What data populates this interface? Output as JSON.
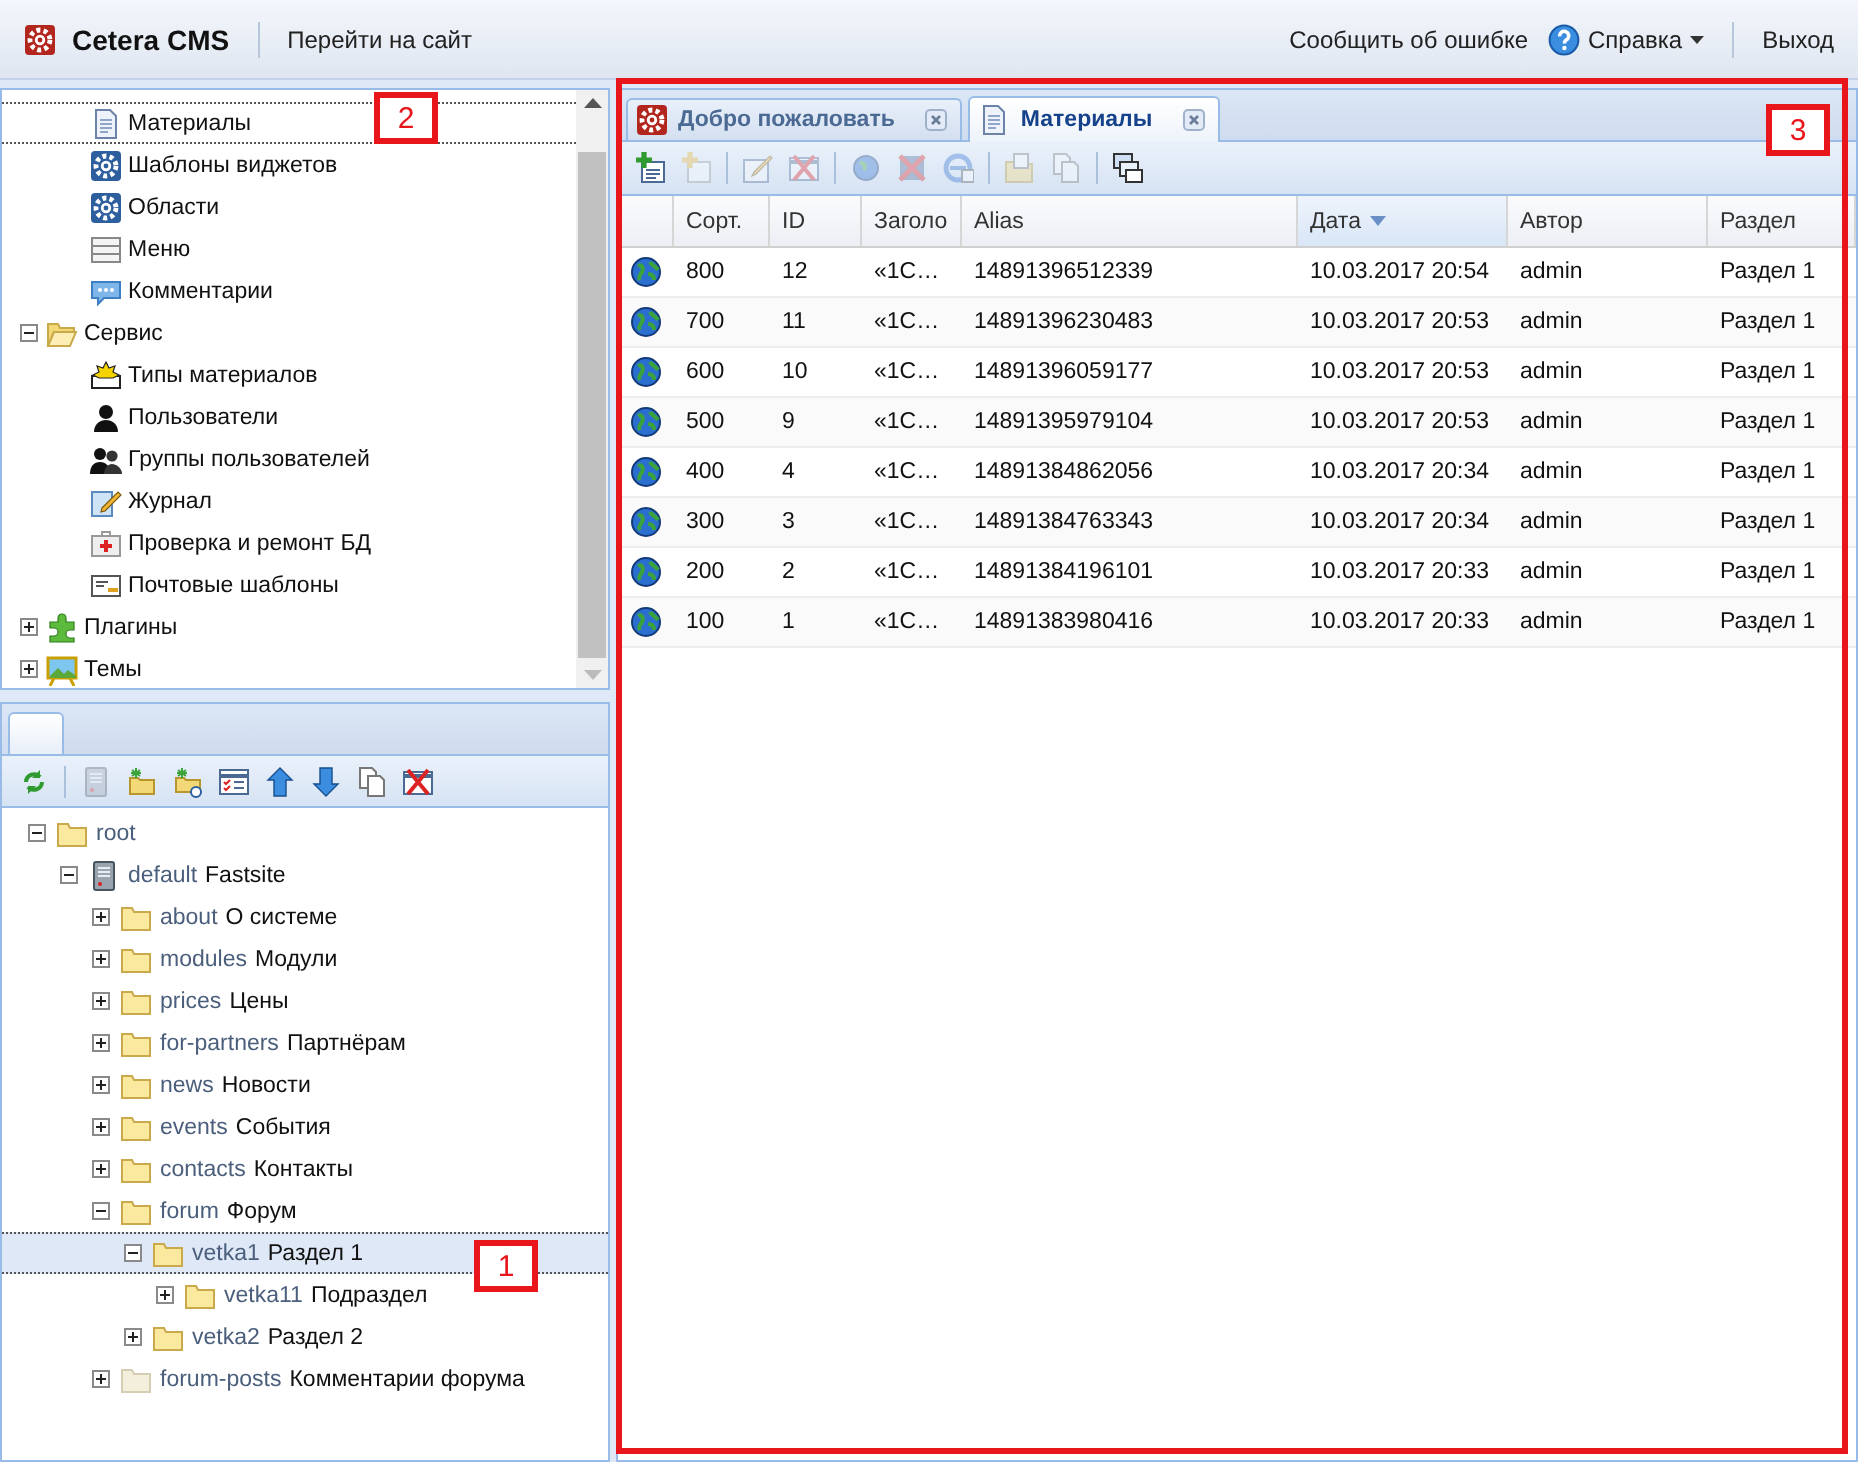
{
  "header": {
    "app_name": "Cetera CMS",
    "site_link": "Перейти на сайт",
    "report_link": "Сообщить об ошибке",
    "help_menu": "Справка",
    "logout": "Выход"
  },
  "nav_panel": {
    "callout": "2",
    "tree": [
      {
        "children": [
          {
            "label": "Материалы",
            "kind": "page",
            "selected": true
          },
          {
            "label": "Шаблоны виджетов",
            "kind": "gear",
            "selected": false
          },
          {
            "label": "Области",
            "kind": "gear",
            "selected": false
          },
          {
            "label": "Меню",
            "kind": "menu",
            "selected": false
          },
          {
            "label": "Комментарии",
            "kind": "comment",
            "selected": false
          }
        ]
      },
      {
        "label": "Сервис",
        "kind": "folder-open",
        "selected": false,
        "expanded": true,
        "children": [
          {
            "label": "Типы материалов",
            "kind": "types",
            "selected": false
          },
          {
            "label": "Пользователи",
            "kind": "user",
            "selected": false
          },
          {
            "label": "Группы пользователей",
            "kind": "users",
            "selected": false
          },
          {
            "label": "Журнал",
            "kind": "journal",
            "selected": false
          },
          {
            "label": "Проверка и ремонт БД",
            "kind": "repair",
            "selected": false
          },
          {
            "label": "Почтовые шаблоны",
            "kind": "mail",
            "selected": false
          }
        ]
      },
      {
        "label": "Плагины",
        "kind": "plugin",
        "selected": false,
        "expanded": false
      },
      {
        "label": "Темы",
        "kind": "theme",
        "selected": false,
        "expanded": false
      }
    ]
  },
  "site_panel": {
    "callout": "1",
    "toolbar": [
      [
        {
          "kind": "refresh",
          "disabled": false
        }
      ],
      [
        {
          "kind": "server",
          "disabled": true
        },
        {
          "kind": "new-folder",
          "disabled": false
        },
        {
          "kind": "new-link",
          "disabled": false
        },
        {
          "kind": "properties",
          "disabled": false
        },
        {
          "kind": "up",
          "disabled": false
        },
        {
          "kind": "down",
          "disabled": false
        },
        {
          "kind": "copy",
          "disabled": false
        },
        {
          "kind": "delete",
          "disabled": false
        }
      ]
    ],
    "tree": [
      {
        "name": "root",
        "kind": "folder",
        "selected": false,
        "expanded": true,
        "children": [
          {
            "name": "default",
            "title": "Fastsite",
            "kind": "server",
            "selected": false,
            "expanded": true,
            "children": [
              {
                "name": "about",
                "title": "О системе",
                "kind": "folder",
                "selected": false,
                "expanded": false
              },
              {
                "name": "modules",
                "title": "Модули",
                "kind": "folder",
                "selected": false,
                "expanded": false
              },
              {
                "name": "prices",
                "title": "Цены",
                "kind": "folder",
                "selected": false,
                "expanded": false
              },
              {
                "name": "for-partners",
                "title": "Партнёрам",
                "kind": "folder",
                "selected": false,
                "expanded": false
              },
              {
                "name": "news",
                "title": "Новости",
                "kind": "folder",
                "selected": false,
                "expanded": false
              },
              {
                "name": "events",
                "title": "События",
                "kind": "folder",
                "selected": false,
                "expanded": false
              },
              {
                "name": "contacts",
                "title": "Контакты",
                "kind": "folder",
                "selected": false,
                "expanded": false
              },
              {
                "name": "forum",
                "title": "Форум",
                "kind": "folder",
                "selected": false,
                "expanded": true,
                "children": [
                  {
                    "name": "vetka1",
                    "title": "Раздел 1",
                    "kind": "folder",
                    "selected": true,
                    "expanded": true,
                    "children": [
                      {
                        "name": "vetka11",
                        "title": "Подраздел",
                        "kind": "folder",
                        "selected": false,
                        "expanded": false
                      }
                    ]
                  },
                  {
                    "name": "vetka2",
                    "title": "Раздел 2",
                    "kind": "folder",
                    "selected": false,
                    "expanded": false
                  }
                ]
              },
              {
                "name": "forum-posts",
                "title": "Комментарии форума",
                "kind": "folder-faded",
                "selected": false,
                "expanded": false
              }
            ]
          }
        ]
      }
    ]
  },
  "materials_panel": {
    "callout": "3",
    "tabs": [
      {
        "label": "Добро пожаловать",
        "kind": "logo",
        "selected": false
      },
      {
        "label": "Материалы",
        "kind": "page",
        "selected": true
      }
    ],
    "toolbar": [
      [
        {
          "kind": "add",
          "disabled": false
        },
        {
          "kind": "add-sub",
          "disabled": true
        }
      ],
      [
        {
          "kind": "edit",
          "disabled": true
        },
        {
          "kind": "delete",
          "disabled": true
        }
      ],
      [
        {
          "kind": "publish",
          "disabled": true
        },
        {
          "kind": "unpublish",
          "disabled": true
        },
        {
          "kind": "preview",
          "disabled": true
        }
      ],
      [
        {
          "kind": "move",
          "disabled": true
        },
        {
          "kind": "copy",
          "disabled": true
        }
      ],
      [
        {
          "kind": "arrange",
          "disabled": false
        }
      ]
    ],
    "table": {
      "columns": [
        {
          "label": "Сорт.",
          "sorted": false
        },
        {
          "label": "ID",
          "sorted": false
        },
        {
          "label": "Заголо",
          "sorted": false
        },
        {
          "label": "Alias",
          "sorted": false
        },
        {
          "label": "Дата",
          "sorted": true
        },
        {
          "label": "Автор",
          "sorted": false
        },
        {
          "label": "Раздел",
          "sorted": false
        }
      ],
      "rows": [
        {
          "cells": [
            "800",
            "12",
            "«1С…",
            "14891396512339",
            "10.03.2017 20:54",
            "admin",
            "Раздел 1"
          ]
        },
        {
          "cells": [
            "700",
            "11",
            "«1С…",
            "14891396230483",
            "10.03.2017 20:53",
            "admin",
            "Раздел 1"
          ]
        },
        {
          "cells": [
            "600",
            "10",
            "«1С…",
            "14891396059177",
            "10.03.2017 20:53",
            "admin",
            "Раздел 1"
          ]
        },
        {
          "cells": [
            "500",
            "9",
            "«1С…",
            "14891395979104",
            "10.03.2017 20:53",
            "admin",
            "Раздел 1"
          ]
        },
        {
          "cells": [
            "400",
            "4",
            "«1С…",
            "14891384862056",
            "10.03.2017 20:34",
            "admin",
            "Раздел 1"
          ]
        },
        {
          "cells": [
            "300",
            "3",
            "«1С…",
            "14891384763343",
            "10.03.2017 20:34",
            "admin",
            "Раздел 1"
          ]
        },
        {
          "cells": [
            "200",
            "2",
            "«1С…",
            "14891384196101",
            "10.03.2017 20:33",
            "admin",
            "Раздел 1"
          ]
        },
        {
          "cells": [
            "100",
            "1",
            "«1С…",
            "14891383980416",
            "10.03.2017 20:33",
            "admin",
            "Раздел 1"
          ]
        }
      ]
    }
  }
}
